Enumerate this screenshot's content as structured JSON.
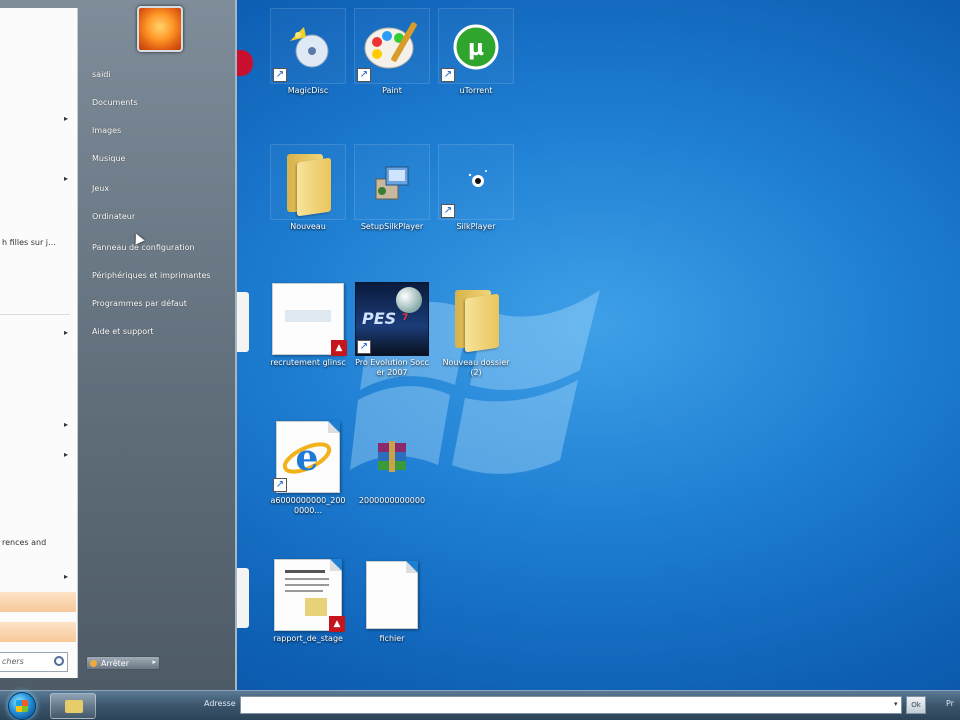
{
  "start_menu": {
    "user_items": [
      "saidi",
      "Documents",
      "Images",
      "Musique",
      "Jeux",
      "Ordinateur",
      "Panneau de configuration",
      "Périphériques et imprimantes",
      "Programmes par défaut",
      "Aide et support"
    ],
    "left_snippets": {
      "snippet_1": "h filles sur j...",
      "snippet_2": "rences and"
    },
    "search_placeholder": "chers",
    "shutdown_label": "Arrêter"
  },
  "desktop": {
    "icons": [
      {
        "label": "MagicDisc",
        "icon": "magicdisc-icon"
      },
      {
        "label": "Paint",
        "icon": "paint-icon"
      },
      {
        "label": "uTorrent",
        "icon": "utorrent-icon"
      },
      {
        "label": "Nouveau",
        "icon": "folder-icon"
      },
      {
        "label": "SetupSilkPlayer",
        "icon": "setup-icon"
      },
      {
        "label": "SilkPlayer",
        "icon": "player-icon"
      },
      {
        "label": "recrutement glinsc",
        "icon": "pdf-icon"
      },
      {
        "label": "Pro Evolution Soccer 2007",
        "icon": "pes-icon"
      },
      {
        "label": "Nouveau dossier (2)",
        "icon": "folder-icon"
      },
      {
        "label": "a6000000000_2000000...",
        "icon": "ie-icon"
      },
      {
        "label": "2000000000000",
        "icon": "winrar-icon"
      },
      {
        "label": "rapport_de_stage",
        "icon": "pdf-icon"
      },
      {
        "label": "fichier",
        "icon": "blank-file-icon"
      }
    ]
  },
  "taskbar": {
    "address_label": "Adresse",
    "go_label": "Ok",
    "right_text": "Pr"
  },
  "colors": {
    "desktop_blue": "#1f7fd3",
    "start_menu_right": "#6b7a86",
    "highlight_orange": "#f7c99a"
  }
}
